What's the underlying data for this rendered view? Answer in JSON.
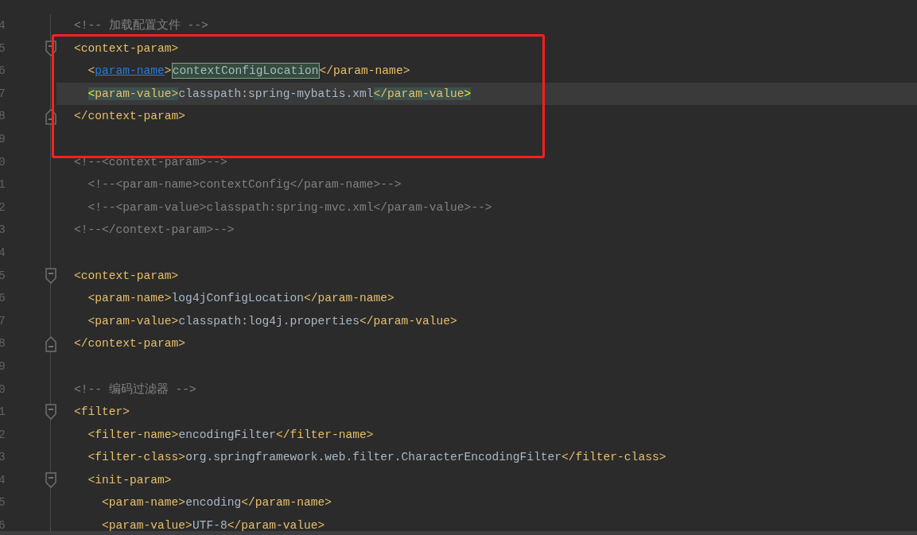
{
  "editor": {
    "lines": [
      {
        "number": "4",
        "current": false,
        "kind": "plain",
        "tokens": [
          {
            "kind": "comment",
            "text": "<!-- 加载配置文件 -->"
          }
        ]
      },
      {
        "number": "5",
        "current": false,
        "kind": "foldstart",
        "tokens": [
          {
            "kind": "tag",
            "text": "<context-param>"
          }
        ]
      },
      {
        "number": "6",
        "current": false,
        "kind": "plain",
        "tokens": [
          {
            "kind": "tag",
            "text": "  <"
          },
          {
            "kind": "link",
            "text": "param-name"
          },
          {
            "kind": "tag",
            "text": ">"
          },
          {
            "kind": "selection",
            "text": "contextConfigLocation"
          },
          {
            "kind": "tag",
            "text": "</param-name>"
          }
        ]
      },
      {
        "number": "7",
        "current": true,
        "kind": "plain",
        "tokens": [
          {
            "kind": "bracket",
            "text": "  <"
          },
          {
            "kind": "matched",
            "text": "param-value>"
          },
          {
            "kind": "text",
            "text": "classpath:spring-mybatis.xml"
          },
          {
            "kind": "matched",
            "text": "</param-value"
          },
          {
            "kind": "bracket",
            "text": ">"
          }
        ]
      },
      {
        "number": "8",
        "current": false,
        "kind": "foldend",
        "tokens": [
          {
            "kind": "tag",
            "text": "</context-param>"
          }
        ]
      },
      {
        "number": "9",
        "current": false,
        "kind": "plain"
      },
      {
        "number": "0",
        "current": false,
        "kind": "plain",
        "tokens": [
          {
            "kind": "comment",
            "text": "<!--<context-param>-->"
          }
        ]
      },
      {
        "number": "1",
        "current": false,
        "kind": "plain",
        "tokens": [
          {
            "kind": "comment",
            "text": "  <!--<param-name>contextConfig</param-name>-->"
          }
        ]
      },
      {
        "number": "2",
        "current": false,
        "kind": "plain",
        "tokens": [
          {
            "kind": "comment",
            "text": "  <!--<param-value>classpath:spring-mvc.xml</param-value>-->"
          }
        ]
      },
      {
        "number": "3",
        "current": false,
        "kind": "plain",
        "tokens": [
          {
            "kind": "comment",
            "text": "<!--</context-param>-->"
          }
        ]
      },
      {
        "number": "4",
        "current": false,
        "kind": "plain"
      },
      {
        "number": "5",
        "current": false,
        "kind": "foldstart",
        "tokens": [
          {
            "kind": "tag",
            "text": "<context-param>"
          }
        ]
      },
      {
        "number": "6",
        "current": false,
        "kind": "plain",
        "tokens": [
          {
            "kind": "tag",
            "text": "  <param-name>"
          },
          {
            "kind": "text",
            "text": "log4jConfigLocation"
          },
          {
            "kind": "tag",
            "text": "</param-name>"
          }
        ]
      },
      {
        "number": "7",
        "current": false,
        "kind": "plain",
        "tokens": [
          {
            "kind": "tag",
            "text": "  <param-value>"
          },
          {
            "kind": "text",
            "text": "classpath:log4j.properties"
          },
          {
            "kind": "tag",
            "text": "</param-value>"
          }
        ]
      },
      {
        "number": "8",
        "current": false,
        "kind": "foldend",
        "tokens": [
          {
            "kind": "tag",
            "text": "</context-param>"
          }
        ]
      },
      {
        "number": "9",
        "current": false,
        "kind": "plain"
      },
      {
        "number": "0",
        "current": false,
        "kind": "plain",
        "tokens": [
          {
            "kind": "comment",
            "text": "<!-- 编码过滤器 -->"
          }
        ]
      },
      {
        "number": "1",
        "current": false,
        "kind": "foldstart",
        "tokens": [
          {
            "kind": "tag",
            "text": "<filter>"
          }
        ]
      },
      {
        "number": "2",
        "current": false,
        "kind": "plain",
        "tokens": [
          {
            "kind": "tag",
            "text": "  <filter-name>"
          },
          {
            "kind": "text",
            "text": "encodingFilter"
          },
          {
            "kind": "tag",
            "text": "</filter-name>"
          }
        ]
      },
      {
        "number": "3",
        "current": false,
        "kind": "plain",
        "tokens": [
          {
            "kind": "tag",
            "text": "  <filter-class>"
          },
          {
            "kind": "text",
            "text": "org.springframework.web.filter.CharacterEncodingFilter"
          },
          {
            "kind": "tag",
            "text": "</filter-class>"
          }
        ]
      },
      {
        "number": "4",
        "current": false,
        "kind": "foldstart",
        "tokens": [
          {
            "kind": "tag",
            "text": "  <init-param>"
          }
        ]
      },
      {
        "number": "5",
        "current": false,
        "kind": "plain",
        "tokens": [
          {
            "kind": "tag",
            "text": "    <param-name>"
          },
          {
            "kind": "text",
            "text": "encoding"
          },
          {
            "kind": "tag",
            "text": "</param-name>"
          }
        ]
      },
      {
        "number": "6",
        "current": false,
        "kind": "plain",
        "tokens": [
          {
            "kind": "tag",
            "text": "    <param-value>"
          },
          {
            "kind": "text",
            "text": "UTF-8"
          },
          {
            "kind": "tag",
            "text": "</param-value>"
          }
        ]
      }
    ]
  }
}
